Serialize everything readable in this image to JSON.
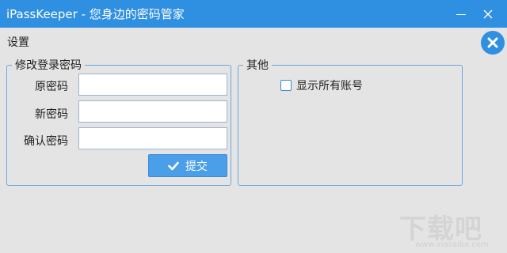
{
  "window": {
    "title": "iPassKeeper  - 您身边的密码管家",
    "titlebar_color": "#2f8fe0",
    "minimize_icon": "minimize-icon",
    "close_icon": "close-icon"
  },
  "page": {
    "settings_label": "设置",
    "close_button_icon": "close-circle-icon"
  },
  "password_group": {
    "legend": "修改登录密码",
    "fields": [
      {
        "label": "原密码",
        "value": ""
      },
      {
        "label": "新密码",
        "value": ""
      },
      {
        "label": "确认密码",
        "value": ""
      }
    ],
    "submit_label": "提交",
    "submit_icon": "check-icon"
  },
  "other_group": {
    "legend": "其他",
    "show_all_accounts_label": "显示所有账号",
    "show_all_accounts_checked": false
  },
  "watermark": {
    "text": "下载吧",
    "subtext": "www.xiazaiba.com"
  }
}
